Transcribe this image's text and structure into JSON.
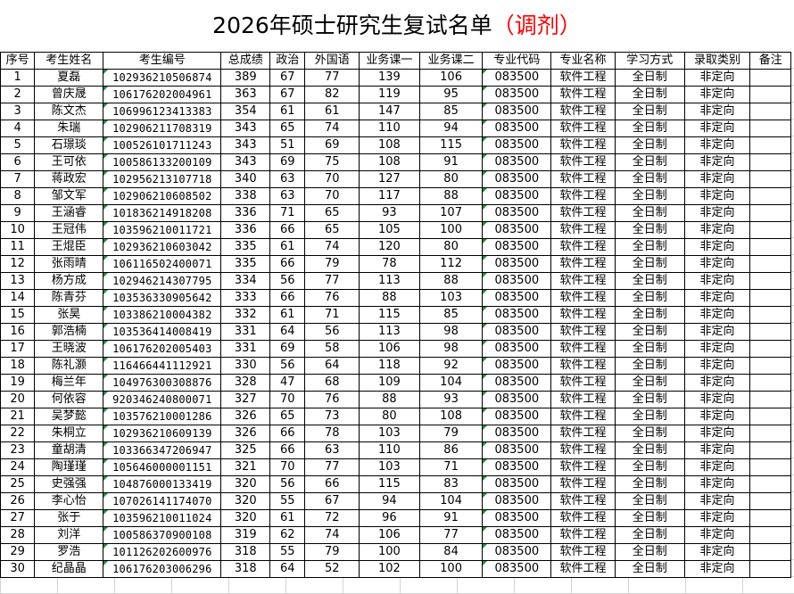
{
  "title": {
    "main": "2026年硕士研究生复试名单",
    "suffix": "（调剂）"
  },
  "columns": [
    "序号",
    "考生姓名",
    "考生编号",
    "总成绩",
    "政治",
    "外国语",
    "业务课一",
    "业务课二",
    "专业代码",
    "专业名称",
    "学习方式",
    "录取类别",
    "备注"
  ],
  "rows": [
    [
      "1",
      "夏磊",
      "102936210506874",
      "389",
      "67",
      "77",
      "139",
      "106",
      "083500",
      "软件工程",
      "全日制",
      "非定向",
      ""
    ],
    [
      "2",
      "曾庆晟",
      "106176202004961",
      "363",
      "67",
      "82",
      "119",
      "95",
      "083500",
      "软件工程",
      "全日制",
      "非定向",
      ""
    ],
    [
      "3",
      "陈文杰",
      "106996123413383",
      "354",
      "61",
      "61",
      "147",
      "85",
      "083500",
      "软件工程",
      "全日制",
      "非定向",
      ""
    ],
    [
      "4",
      "朱瑞",
      "102906211708319",
      "343",
      "65",
      "74",
      "110",
      "94",
      "083500",
      "软件工程",
      "全日制",
      "非定向",
      ""
    ],
    [
      "5",
      "石璟琰",
      "100526101711243",
      "343",
      "51",
      "69",
      "108",
      "115",
      "083500",
      "软件工程",
      "全日制",
      "非定向",
      ""
    ],
    [
      "6",
      "王可依",
      "100586133200109",
      "343",
      "69",
      "75",
      "108",
      "91",
      "083500",
      "软件工程",
      "全日制",
      "非定向",
      ""
    ],
    [
      "7",
      "蒋政宏",
      "102956213107718",
      "340",
      "63",
      "70",
      "127",
      "80",
      "083500",
      "软件工程",
      "全日制",
      "非定向",
      ""
    ],
    [
      "8",
      "邹文军",
      "102906210608502",
      "338",
      "63",
      "70",
      "117",
      "88",
      "083500",
      "软件工程",
      "全日制",
      "非定向",
      ""
    ],
    [
      "9",
      "王涵睿",
      "101836214918208",
      "336",
      "71",
      "65",
      "93",
      "107",
      "083500",
      "软件工程",
      "全日制",
      "非定向",
      ""
    ],
    [
      "10",
      "王冠伟",
      "103596210011721",
      "336",
      "66",
      "65",
      "105",
      "100",
      "083500",
      "软件工程",
      "全日制",
      "非定向",
      ""
    ],
    [
      "11",
      "王焜臣",
      "102936210603042",
      "335",
      "61",
      "74",
      "120",
      "80",
      "083500",
      "软件工程",
      "全日制",
      "非定向",
      ""
    ],
    [
      "12",
      "张雨晴",
      "106116502400071",
      "335",
      "66",
      "79",
      "78",
      "112",
      "083500",
      "软件工程",
      "全日制",
      "非定向",
      ""
    ],
    [
      "13",
      "杨方成",
      "102946214307795",
      "334",
      "56",
      "77",
      "113",
      "88",
      "083500",
      "软件工程",
      "全日制",
      "非定向",
      ""
    ],
    [
      "14",
      "陈青芬",
      "103536330905642",
      "333",
      "66",
      "76",
      "88",
      "103",
      "083500",
      "软件工程",
      "全日制",
      "非定向",
      ""
    ],
    [
      "15",
      "张昊",
      "103386210004382",
      "332",
      "61",
      "71",
      "115",
      "85",
      "083500",
      "软件工程",
      "全日制",
      "非定向",
      ""
    ],
    [
      "16",
      "郭浩楠",
      "103536414008419",
      "331",
      "64",
      "56",
      "113",
      "98",
      "083500",
      "软件工程",
      "全日制",
      "非定向",
      ""
    ],
    [
      "17",
      "王晓波",
      "106176202005403",
      "331",
      "69",
      "58",
      "106",
      "98",
      "083500",
      "软件工程",
      "全日制",
      "非定向",
      ""
    ],
    [
      "18",
      "陈礼灏",
      "116466441112921",
      "330",
      "56",
      "64",
      "118",
      "92",
      "083500",
      "软件工程",
      "全日制",
      "非定向",
      ""
    ],
    [
      "19",
      "梅兰年",
      "104976300308876",
      "328",
      "47",
      "68",
      "109",
      "104",
      "083500",
      "软件工程",
      "全日制",
      "非定向",
      ""
    ],
    [
      "20",
      "何依容",
      "920346240800071",
      "327",
      "70",
      "76",
      "88",
      "93",
      "083500",
      "软件工程",
      "全日制",
      "非定向",
      ""
    ],
    [
      "21",
      "吴梦懿",
      "103576210001286",
      "326",
      "65",
      "73",
      "80",
      "108",
      "083500",
      "软件工程",
      "全日制",
      "非定向",
      ""
    ],
    [
      "22",
      "朱桐立",
      "102936210609139",
      "326",
      "66",
      "78",
      "103",
      "79",
      "083500",
      "软件工程",
      "全日制",
      "非定向",
      ""
    ],
    [
      "23",
      "童胡清",
      "103366347206947",
      "325",
      "66",
      "63",
      "110",
      "86",
      "083500",
      "软件工程",
      "全日制",
      "非定向",
      ""
    ],
    [
      "24",
      "陶瑾瑾",
      "105646000001151",
      "321",
      "70",
      "77",
      "103",
      "71",
      "083500",
      "软件工程",
      "全日制",
      "非定向",
      ""
    ],
    [
      "25",
      "史强强",
      "104876000133419",
      "320",
      "56",
      "66",
      "115",
      "83",
      "083500",
      "软件工程",
      "全日制",
      "非定向",
      ""
    ],
    [
      "26",
      "李心怡",
      "107026141174070",
      "320",
      "55",
      "67",
      "94",
      "104",
      "083500",
      "软件工程",
      "全日制",
      "非定向",
      ""
    ],
    [
      "27",
      "张于",
      "103596210011024",
      "320",
      "61",
      "72",
      "96",
      "91",
      "083500",
      "软件工程",
      "全日制",
      "非定向",
      ""
    ],
    [
      "28",
      "刘洋",
      "100586370900108",
      "319",
      "62",
      "74",
      "106",
      "77",
      "083500",
      "软件工程",
      "全日制",
      "非定向",
      ""
    ],
    [
      "29",
      "罗浩",
      "101126202600976",
      "318",
      "55",
      "79",
      "100",
      "84",
      "083500",
      "软件工程",
      "全日制",
      "非定向",
      ""
    ],
    [
      "30",
      "纪晶晶",
      "106176203006296",
      "318",
      "64",
      "52",
      "102",
      "100",
      "083500",
      "软件工程",
      "全日制",
      "非定向",
      ""
    ]
  ]
}
